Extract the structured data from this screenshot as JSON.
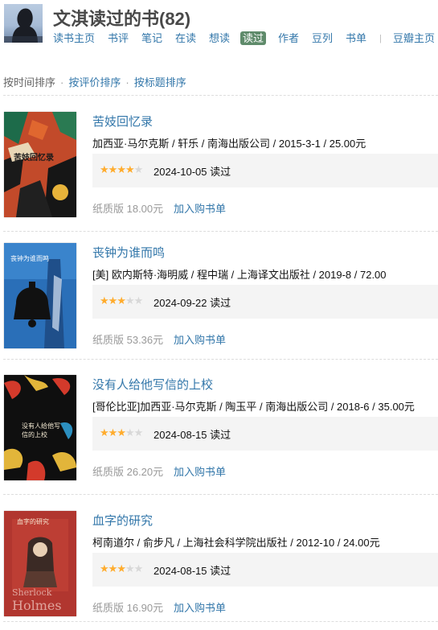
{
  "header": {
    "title": "文淇读过的书(82)",
    "nav": [
      {
        "label": "读书主页",
        "active": false
      },
      {
        "label": "书评",
        "active": false
      },
      {
        "label": "笔记",
        "active": false
      },
      {
        "label": "在读",
        "active": false
      },
      {
        "label": "想读",
        "active": false
      },
      {
        "label": "读过",
        "active": true
      },
      {
        "label": "作者",
        "active": false
      },
      {
        "label": "豆列",
        "active": false
      },
      {
        "label": "书单",
        "active": false
      },
      {
        "label": "豆瓣主页",
        "active": false
      }
    ],
    "nav_separator": "|"
  },
  "sort": {
    "current": "按时间排序",
    "dot": "·",
    "by_rating": "按评价排序",
    "by_title": "按标题排序"
  },
  "books": [
    {
      "title": "苦妓回忆录",
      "pub": "加西亚·马尔克斯 / 轩乐 / 南海出版公司 / 2015-3-1 / 25.00元",
      "rating": 4,
      "read_date": "2024-10-05 读过",
      "price": "纸质版 18.00元",
      "cart": "加入购书单",
      "cover_text": "苦妓回忆录"
    },
    {
      "title": "丧钟为谁而鸣",
      "pub": "[美] 欧内斯特·海明威 / 程中瑞 / 上海译文出版社 / 2019-8 / 72.00",
      "rating": 3,
      "read_date": "2024-09-22 读过",
      "price": "纸质版 53.36元",
      "cart": "加入购书单",
      "cover_text": "丧钟为谁而鸣"
    },
    {
      "title": "没有人给他写信的上校",
      "pub": "[哥伦比亚]加西亚·马尔克斯 / 陶玉平 / 南海出版公司 / 2018-6 / 35.00元",
      "rating": 3,
      "read_date": "2024-08-15 读过",
      "price": "纸质版 26.20元",
      "cart": "加入购书单",
      "cover_text": "没有人给他写信的上校"
    },
    {
      "title": "血字的研究",
      "pub": "柯南道尔 / 俞步凡 / 上海社会科学院出版社 / 2012-10 / 24.00元",
      "rating": 3,
      "read_date": "2024-08-15 读过",
      "price": "纸质版 16.90元",
      "cart": "加入购书单",
      "cover_text": "血字的研究",
      "cover_text_2": "Sherlock",
      "cover_text_3": "Holmes"
    }
  ],
  "colors": {
    "link": "#3377aa",
    "active_tab": "#5f8b6b",
    "star_on": "#ffac2d",
    "star_off": "#d8d8d8",
    "rating_bg": "#f4f4f4"
  }
}
